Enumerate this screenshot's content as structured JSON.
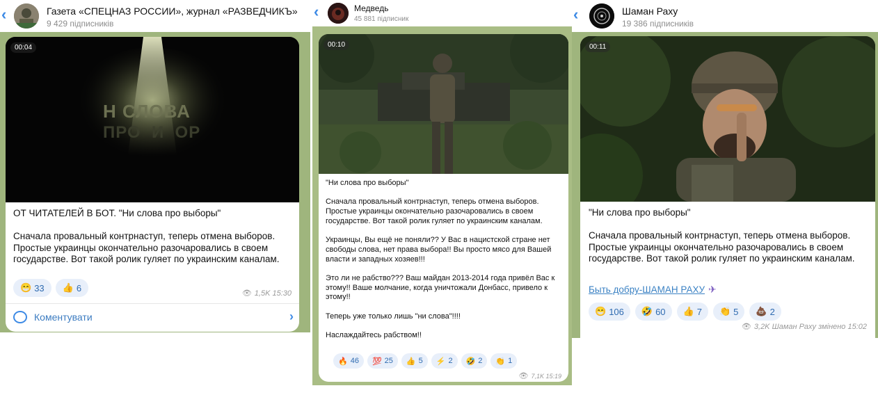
{
  "panels": [
    {
      "channel_name": "Газета «СПЕЦНАЗ РОССИИ», журнал «РАЗВЕДЧИКЪ»",
      "subscribers": "9 429 підписників",
      "video_duration": "00:04",
      "video_overlay_line1": "Н СЛОВА",
      "video_overlay_line2": "ПРО  И  ОР",
      "post_text": "ОТ ЧИТАТЕЛЕЙ В БОТ. \"Ни слова про выборы\"\n\nСначала провальный контрнаступ, теперь отмена выборов. Простые украинцы окончательно разочаровались в своем государстве. Вот такой ролик гуляет по украинским каналам.",
      "reactions": [
        {
          "icon": "grinning-face",
          "emoji": "😁",
          "count": "33"
        },
        {
          "icon": "thumbs-up",
          "emoji": "👍",
          "count": "6"
        }
      ],
      "views_time": "1,5K 15:30",
      "comment_label": "Коментувати"
    },
    {
      "channel_name": "Медведь",
      "subscribers": "45 881 підписник",
      "video_duration": "00:10",
      "post_text": "\"Ни слова про выборы\"\n\nСначала провальный контрнаступ, теперь отмена выборов. Простые украинцы окончательно разочаровались в своем государстве. Вот такой ролик гуляет по украинским каналам.\n\nУкраинцы, Вы ещё не поняли?? У Вас в нацистской стране нет свободы слова, нет права выбора!! Вы просто мясо для Вашей власти и западных хозяев!!!\n\nЭто ли не рабство??? Ваш майдан 2013-2014 года привёл Вас к этому!! Ваше молчание, когда уничтожали Донбасс, привело к этому!!\n\nТеперь уже только лишь \"ни слова\"!!!!\n\nНаслаждайтесь рабством!!",
      "reactions": [
        {
          "icon": "fire",
          "emoji": "🔥",
          "count": "46"
        },
        {
          "icon": "hundred-points",
          "emoji": "💯",
          "count": "25"
        },
        {
          "icon": "thumbs-up",
          "emoji": "👍",
          "count": "5"
        },
        {
          "icon": "high-voltage",
          "emoji": "⚡",
          "count": "2"
        },
        {
          "icon": "rolling-laughing",
          "emoji": "🤣",
          "count": "2"
        },
        {
          "icon": "clapping-hands",
          "emoji": "👏",
          "count": "1"
        }
      ],
      "views_time": "7,1K 15:19"
    },
    {
      "channel_name": "Шаман Раху",
      "subscribers": "19 386 підписників",
      "video_duration": "00:11",
      "post_text": "\"Ни слова про выборы\"\n\nСначала провальный контрнаступ, теперь отмена выборов. Простые украинцы окончательно разочаровались в своем государстве. Вот такой ролик гуляет по украинским каналам.",
      "link_text": "Быть добру-ШАМАН РАХУ",
      "link_icon": "✈",
      "reactions": [
        {
          "icon": "grinning-face",
          "emoji": "😁",
          "count": "106"
        },
        {
          "icon": "rolling-laughing",
          "emoji": "🤣",
          "count": "60"
        },
        {
          "icon": "thumbs-up",
          "emoji": "👍",
          "count": "7"
        },
        {
          "icon": "clapping-hands",
          "emoji": "👏",
          "count": "5"
        },
        {
          "icon": "pile-of-poo",
          "emoji": "💩",
          "count": "2"
        }
      ],
      "views_time": "3,2K Шаман Раху змінено 15:02"
    }
  ],
  "colors": {
    "chat_background": "#9fb57d",
    "accent": "#3d8ae5",
    "reaction_bg": "#e8effa",
    "reaction_text": "#2f6bb1"
  }
}
